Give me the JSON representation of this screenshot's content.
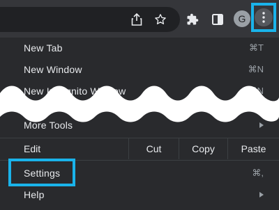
{
  "toolbar": {
    "icons": [
      "share-icon",
      "star-icon",
      "extensions-icon",
      "sidepanel-icon",
      "kebab-menu-icon"
    ],
    "profile_initial": "G"
  },
  "menu": {
    "new_tab": {
      "label": "New Tab",
      "shortcut": "⌘T"
    },
    "new_window": {
      "label": "New Window",
      "shortcut": "⌘N"
    },
    "new_incognito": {
      "label": "New Incognito Window",
      "shortcut": "⇧⌘N"
    },
    "more_tools": {
      "label": "More Tools"
    },
    "edit": {
      "label": "Edit",
      "cut": "Cut",
      "copy": "Copy",
      "paste": "Paste"
    },
    "settings": {
      "label": "Settings",
      "shortcut": "⌘,"
    },
    "help": {
      "label": "Help"
    }
  },
  "colors": {
    "highlight": "#1ab3ea",
    "menu_bg": "#292a2d",
    "toolbar_bg": "#35363a"
  }
}
